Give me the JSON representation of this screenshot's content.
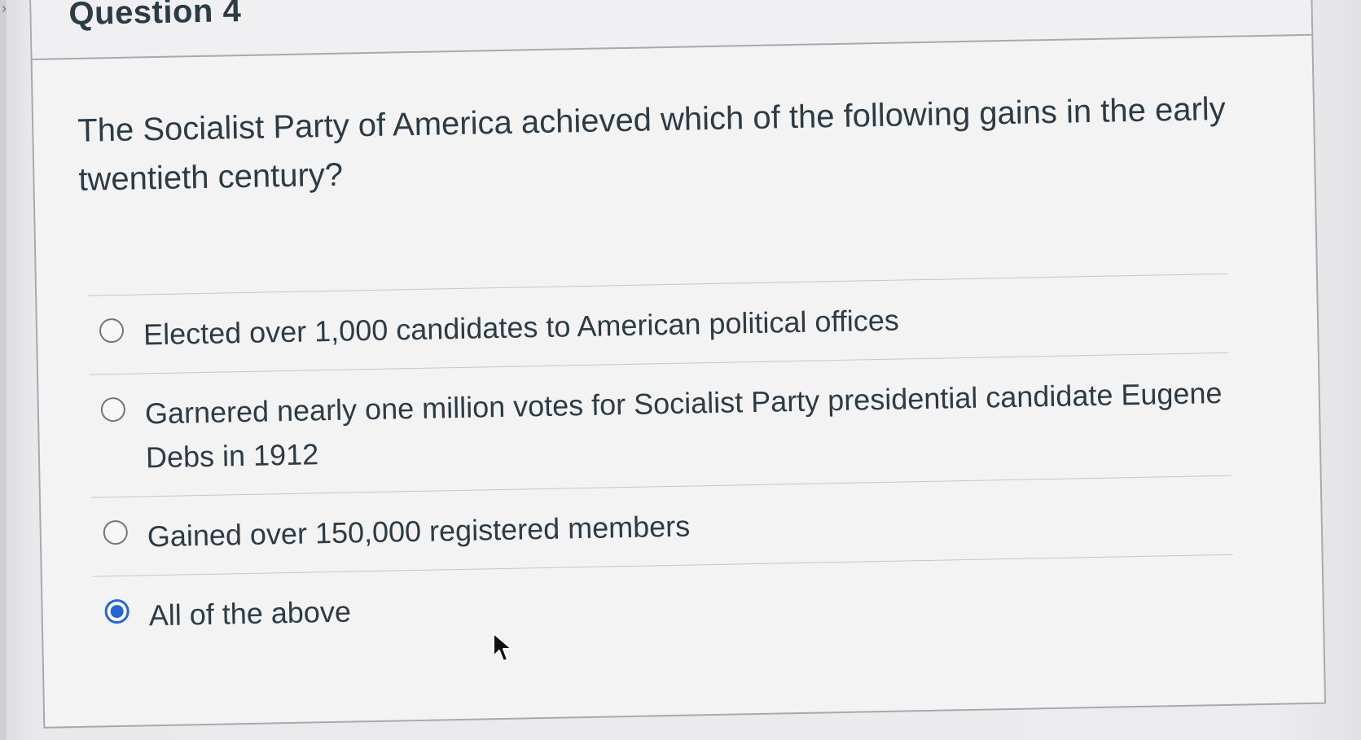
{
  "question": {
    "title": "Question 4",
    "text": "The Socialist Party of America achieved which of the following gains in the early twentieth century?"
  },
  "answers": [
    {
      "label": "Elected over 1,000 candidates to American political offices",
      "selected": false
    },
    {
      "label": "Garnered nearly one million votes for Socialist Party presidential candidate Eugene Debs in 1912",
      "selected": false
    },
    {
      "label": "Gained over 150,000 registered members",
      "selected": false
    },
    {
      "label": "All of the above",
      "selected": true
    }
  ],
  "colors": {
    "accent": "#2466d6",
    "text": "#2d3b45",
    "border": "#a9a9ad"
  },
  "icons": {
    "radio": "radio-button-icon",
    "cursor": "mouse-pointer-icon"
  }
}
